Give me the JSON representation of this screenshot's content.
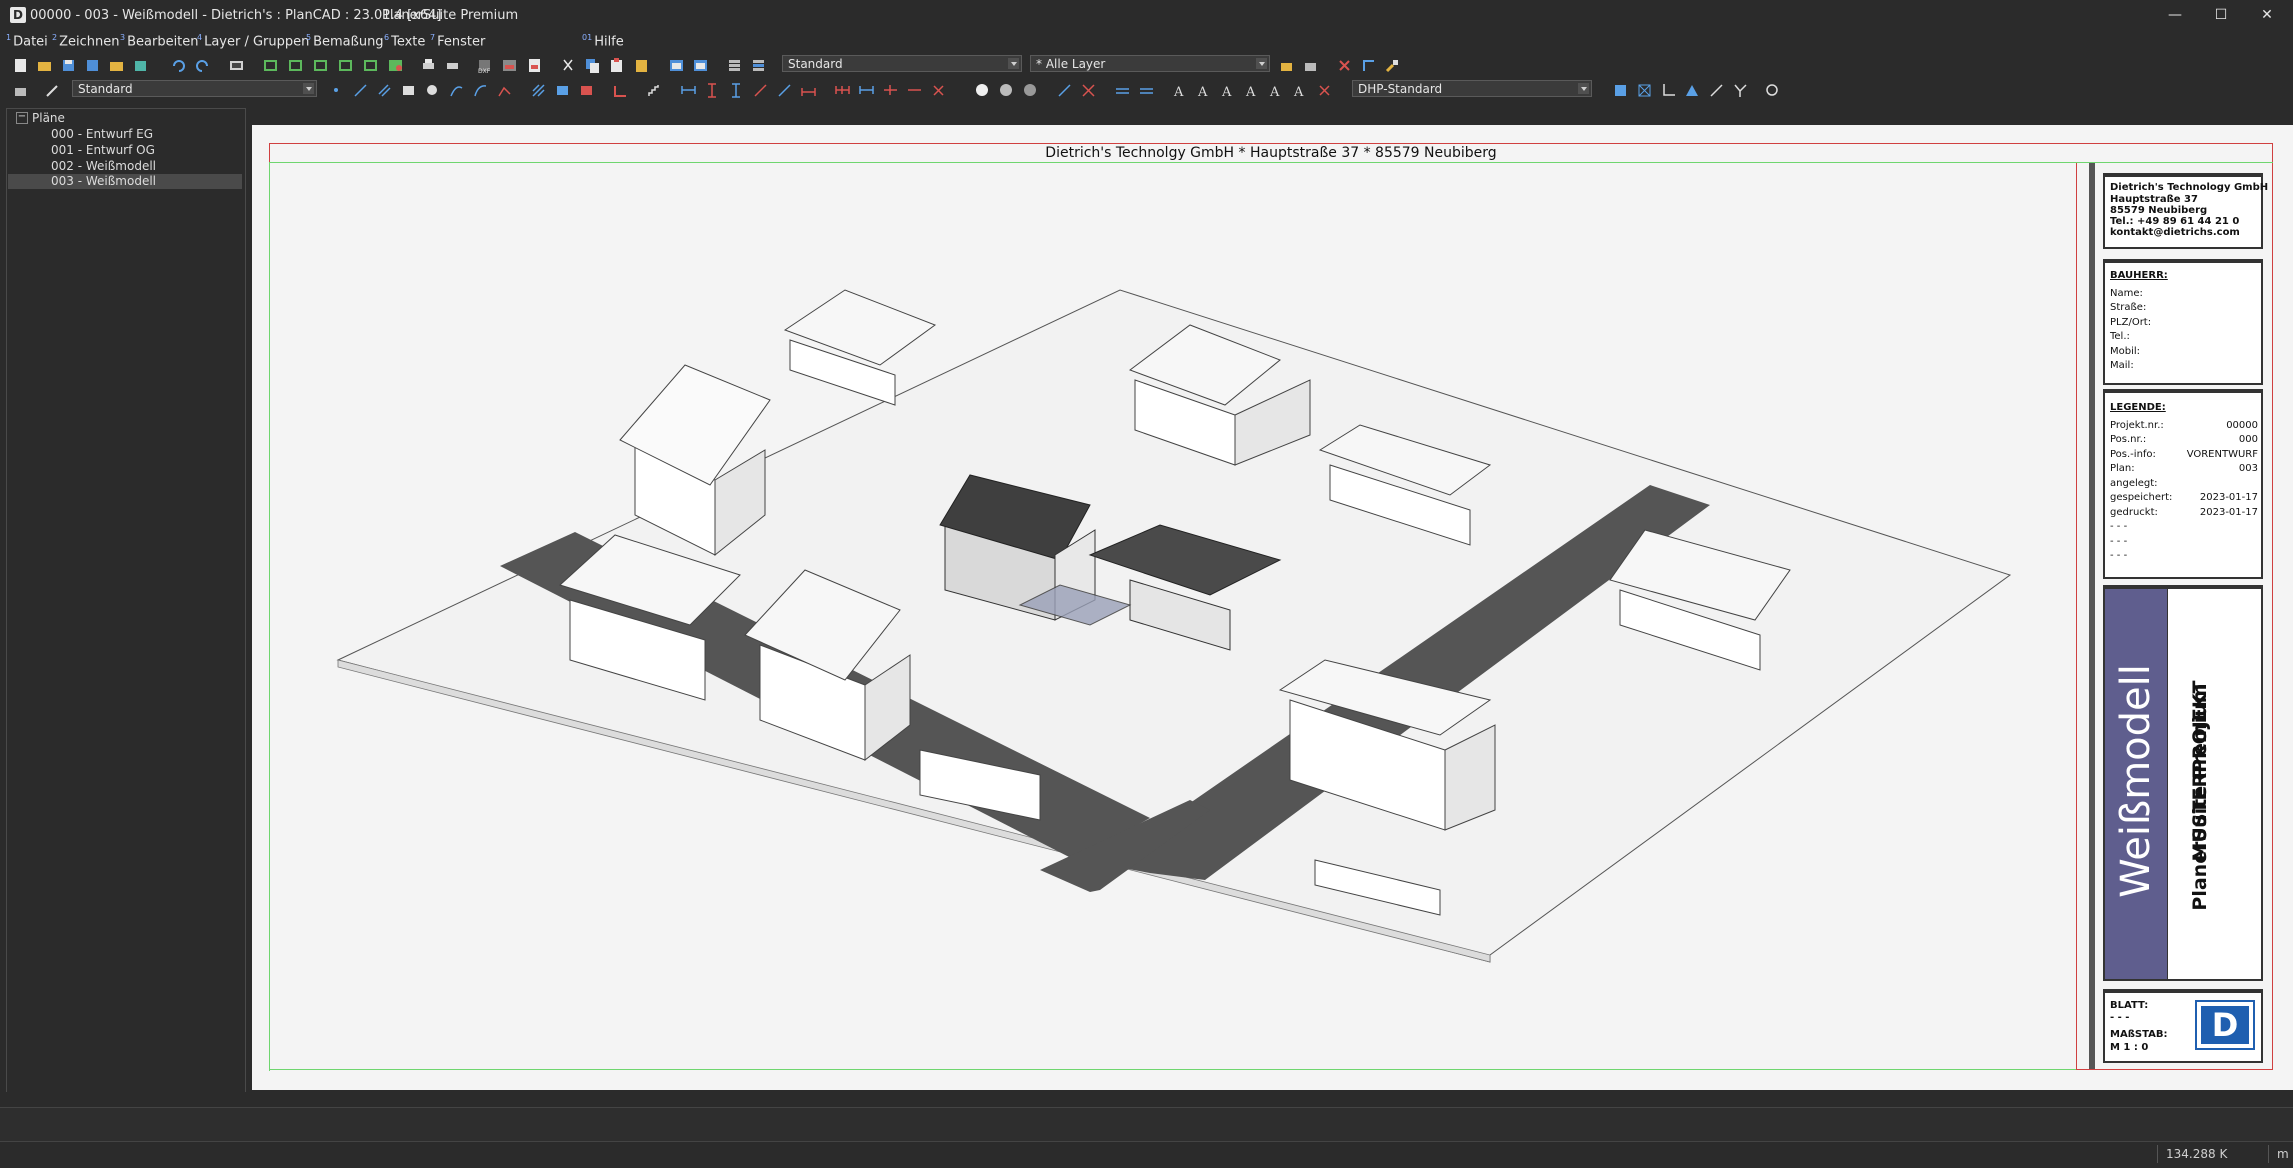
{
  "window": {
    "title": "00000 - 003 - Weißmodell - Dietrich's : PlanCAD : 23.01.4 [x64]",
    "edition": "PlanerSuite Premium",
    "app_icon": "D",
    "controls": {
      "minimize": "—",
      "maximize": "☐",
      "close": "✕"
    }
  },
  "menu": [
    {
      "num": "1",
      "label": "Datei"
    },
    {
      "num": "2",
      "label": "Zeichnen"
    },
    {
      "num": "3",
      "label": "Bearbeiten"
    },
    {
      "num": "4",
      "label": "Layer / Gruppen"
    },
    {
      "num": "5",
      "label": "Bemaßung"
    },
    {
      "num": "6",
      "label": "Texte"
    },
    {
      "num": "7",
      "label": "Fenster"
    },
    {
      "num": "01",
      "label": "Hilfe"
    }
  ],
  "toolbar": {
    "layer_style_combo": "Standard",
    "layer_filter_combo": "* Alle Layer",
    "pen_combo": "Standard",
    "dim_style_combo": "DHP-Standard"
  },
  "tree": {
    "root": "Pläne",
    "items": [
      {
        "label": "000 - Entwurf EG",
        "selected": false
      },
      {
        "label": "001 - Entwurf OG",
        "selected": false
      },
      {
        "label": "002 - Weißmodell",
        "selected": false
      },
      {
        "label": "003 - Weißmodell",
        "selected": true
      }
    ]
  },
  "sheet": {
    "header": "Dietrich's Technolgy GmbH * Hauptstraße 37 * 85579 Neubiberg",
    "company": {
      "name": "Dietrich's Technology GmbH",
      "street": "Hauptstraße 37",
      "city": "85579 Neubiberg",
      "tel": "Tel.: +49 89 61 44 21 0",
      "mail": "kontakt@dietrichs.com"
    },
    "bauherr": {
      "heading": "BAUHERR:",
      "fields": [
        "Name:",
        "Straße:",
        "PLZ/Ort:",
        "Tel.:",
        "Mobil:",
        "Mail:"
      ]
    },
    "legende": {
      "heading": "LEGENDE:",
      "rows": [
        {
          "label": "Projekt.nr.:",
          "value": "00000"
        },
        {
          "label": "Pos.nr.:",
          "value": "000"
        },
        {
          "label": "Pos.-info:",
          "value": "VORENTWURF"
        },
        {
          "label": "Plan:",
          "value": "003"
        },
        {
          "label": "angelegt:",
          "value": ""
        },
        {
          "label": "gespeichert:",
          "value": "2023-01-17"
        },
        {
          "label": "gedruckt:",
          "value": "2023-01-17"
        },
        {
          "label": "- - -",
          "value": ""
        },
        {
          "label": "- - -",
          "value": ""
        },
        {
          "label": "- - -",
          "value": ""
        }
      ]
    },
    "vertical_title": "Weißmodell",
    "project_line1": "MUSTERPROJEKT",
    "project_line2": "PlanerSuite Premium",
    "blatt_label": "BLATT:",
    "blatt_value": "- - -",
    "massstab_label": "MAßSTAB:",
    "massstab_value": "M 1 : 0",
    "logo_letter": "D",
    "accent_color": "#5f5e8e"
  },
  "status": {
    "memory": "134.288 K",
    "unit": "m"
  }
}
